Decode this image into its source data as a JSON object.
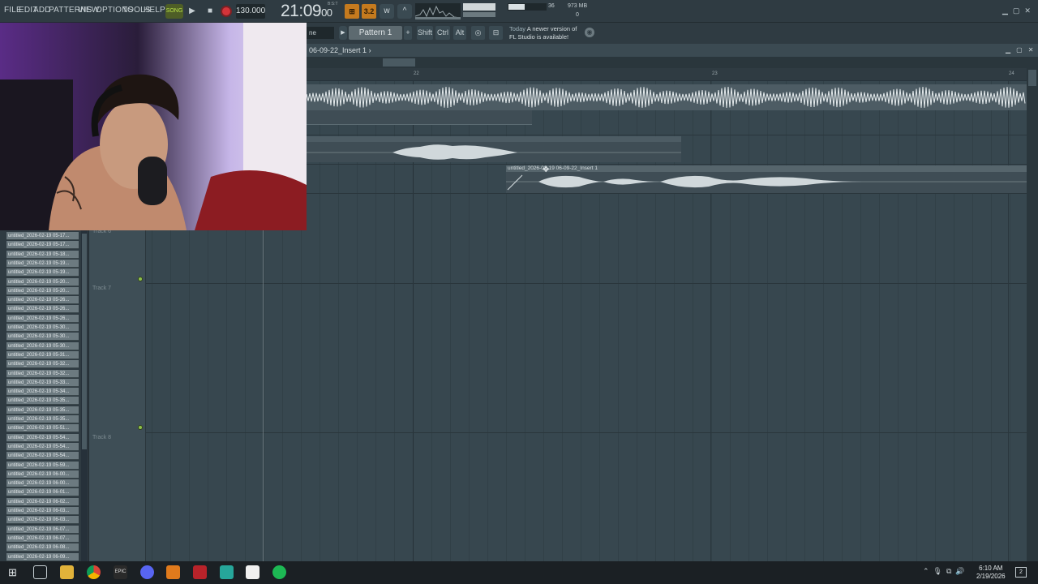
{
  "menu": {
    "file": "FILE",
    "edit": "EDIT",
    "add": "ADD",
    "patterns": "PATTERNS",
    "view": "VIEW",
    "options": "OPTIONS",
    "tools": "TOOLS",
    "help": "HELP"
  },
  "transport": {
    "song_mode": "SONG",
    "tempo": "130.000",
    "clock": "21:09",
    "clock_frames": "00",
    "clock_sub": "B:S:T",
    "play_icon": "play-icon",
    "stop_icon": "stop-icon",
    "record_icon": "record-icon"
  },
  "monitor": {
    "cpu": "36",
    "memory": "973 MB",
    "polyphony": "0"
  },
  "toolbar2": {
    "snap": "ne",
    "pattern": "Pattern 1",
    "add": "+",
    "shift": "Shift",
    "ctrl": "Ctrl",
    "alt": "Alt",
    "hint_line1": "Today",
    "hint_line1b": "A newer version of",
    "hint_line2": "FL Studio is available!"
  },
  "playlist": {
    "title": "06-09-22_Insert 1",
    "title_arrow": "›",
    "bar_22": "22",
    "bar_23": "23",
    "bar_24": "24",
    "clip_name": "untitled_2026-02-19 06-09-22_Insert 1",
    "track6": "Track 6",
    "track7": "Track 7",
    "track8": "Track 8"
  },
  "browser": {
    "files": [
      "untitled_2026-02-19 05-17...",
      "untitled_2026-02-19 05-17...",
      "untitled_2026-02-19 05-18...",
      "untitled_2026-02-19 05-19...",
      "untitled_2026-02-19 05-19...",
      "untitled_2026-02-19 05-20...",
      "untitled_2026-02-19 05-20...",
      "untitled_2026-02-19 05-26...",
      "untitled_2026-02-19 05-26...",
      "untitled_2026-02-19 05-26...",
      "untitled_2026-02-19 05-30...",
      "untitled_2026-02-19 05-30...",
      "untitled_2026-02-19 05-30...",
      "untitled_2026-02-19 05-31...",
      "untitled_2026-02-19 05-32...",
      "untitled_2026-02-19 05-32...",
      "untitled_2026-02-19 05-33...",
      "untitled_2026-02-19 05-34...",
      "untitled_2026-02-19 05-35...",
      "untitled_2026-02-19 05-35...",
      "untitled_2026-02-19 05-35...",
      "untitled_2026-02-19 05-51...",
      "untitled_2026-02-19 05-54...",
      "untitled_2026-02-19 05-54...",
      "untitled_2026-02-19 05-54...",
      "untitled_2026-02-19 05-59...",
      "untitled_2026-02-19 06-00...",
      "untitled_2026-02-19 06-00...",
      "untitled_2026-02-19 06-01...",
      "untitled_2026-02-19 06-02...",
      "untitled_2026-02-19 06-03...",
      "untitled_2026-02-19 06-03...",
      "untitled_2026-02-19 06-07...",
      "untitled_2026-02-19 06-07...",
      "untitled_2026-02-19 06-08...",
      "untitled_2026-02-19 06-09..."
    ]
  },
  "taskbar": {
    "time": "6:10 AM",
    "date": "2/19/2026",
    "notifications": "2",
    "apps": [
      "windows-icon",
      "search-icon",
      "file-explorer-icon",
      "chrome-icon",
      "epic-games-icon",
      "discord-icon",
      "fl-studio-icon",
      "voicemeeter-icon",
      "app-icon",
      "capcut-icon",
      "spotify-icon"
    ]
  },
  "colors": {
    "background": "#34444c",
    "accent_orange": "#c57a1e",
    "record_red": "#d4343a",
    "song_green": "#b6e04a",
    "waveform": "#d9e0e3"
  }
}
